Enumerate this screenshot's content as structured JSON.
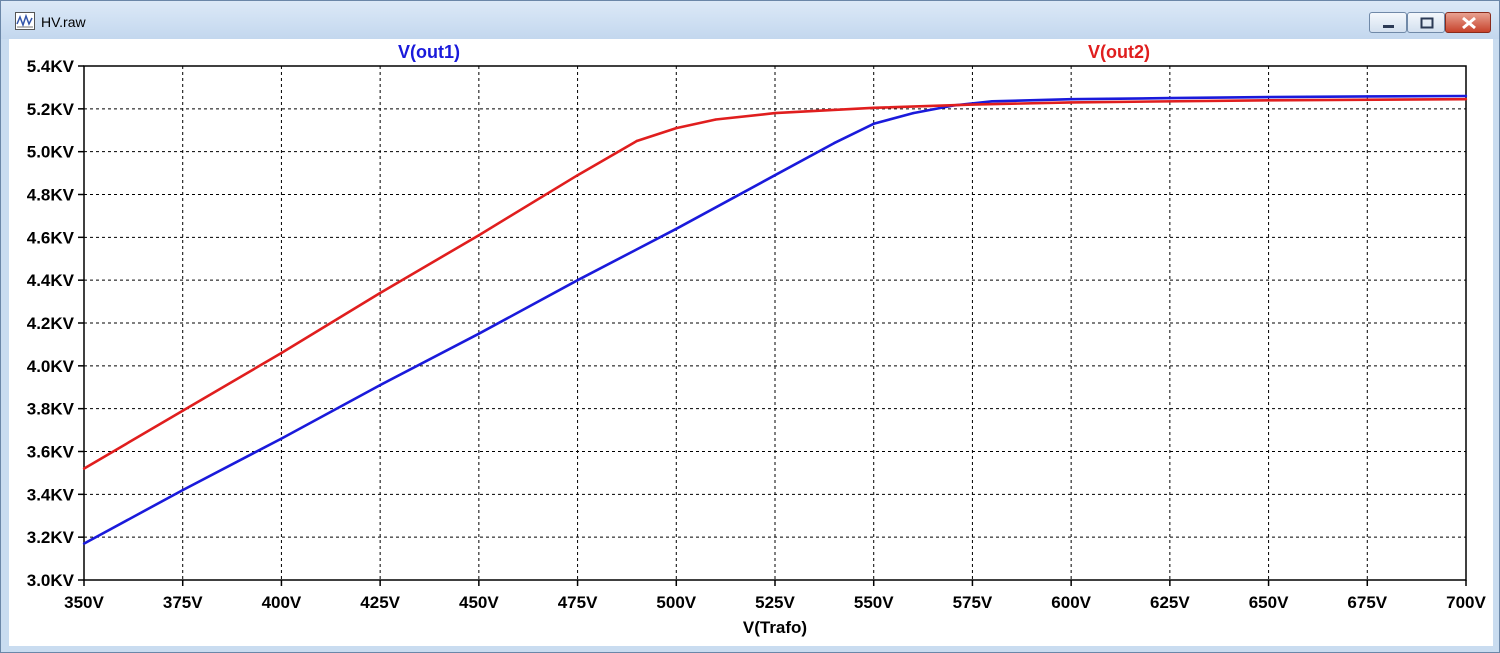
{
  "window": {
    "title": "HV.raw",
    "icon": "waveform-window-icon",
    "controls": [
      "minimize-icon",
      "maximize-icon",
      "close-icon"
    ]
  },
  "colors": {
    "series1": "#1a1adb",
    "series2": "#e01e1e",
    "axis": "#000000",
    "grid": "#000000",
    "background": "#ffffff",
    "close_button": "#c7432c"
  },
  "chart_data": {
    "type": "line",
    "title": "",
    "xlabel": "V(Trafo)",
    "ylabel": "",
    "xlim": [
      350,
      700
    ],
    "ylim": [
      3.0,
      5.4
    ],
    "grid": true,
    "grid_style": "dashed",
    "x_ticks": [
      350,
      375,
      400,
      425,
      450,
      475,
      500,
      525,
      550,
      575,
      600,
      625,
      650,
      675,
      700
    ],
    "y_ticks": [
      3.0,
      3.2,
      3.4,
      3.6,
      3.8,
      4.0,
      4.2,
      4.4,
      4.6,
      4.8,
      5.0,
      5.2,
      5.4
    ],
    "x_tick_labels": [
      "350V",
      "375V",
      "400V",
      "425V",
      "450V",
      "475V",
      "500V",
      "525V",
      "550V",
      "575V",
      "600V",
      "625V",
      "650V",
      "675V",
      "700V"
    ],
    "y_tick_labels": [
      "3.0KV",
      "3.2KV",
      "3.4KV",
      "3.6KV",
      "3.8KV",
      "4.0KV",
      "4.2KV",
      "4.4KV",
      "4.6KV",
      "4.8KV",
      "5.0KV",
      "5.2KV",
      "5.4KV"
    ],
    "series": [
      {
        "name": "V(out1)",
        "color": "#1a1adb",
        "x": [
          350,
          375,
          400,
          425,
          450,
          475,
          500,
          525,
          540,
          550,
          560,
          570,
          580,
          600,
          625,
          650,
          675,
          700
        ],
        "y": [
          3.17,
          3.42,
          3.66,
          3.91,
          4.15,
          4.4,
          4.64,
          4.89,
          5.04,
          5.13,
          5.18,
          5.215,
          5.235,
          5.245,
          5.25,
          5.255,
          5.258,
          5.26
        ]
      },
      {
        "name": "V(out2)",
        "color": "#e01e1e",
        "x": [
          350,
          375,
          400,
          425,
          450,
          475,
          490,
          500,
          510,
          525,
          550,
          575,
          600,
          650,
          700
        ],
        "y": [
          3.52,
          3.79,
          4.06,
          4.34,
          4.61,
          4.89,
          5.05,
          5.11,
          5.15,
          5.18,
          5.205,
          5.22,
          5.23,
          5.24,
          5.245
        ]
      }
    ]
  }
}
